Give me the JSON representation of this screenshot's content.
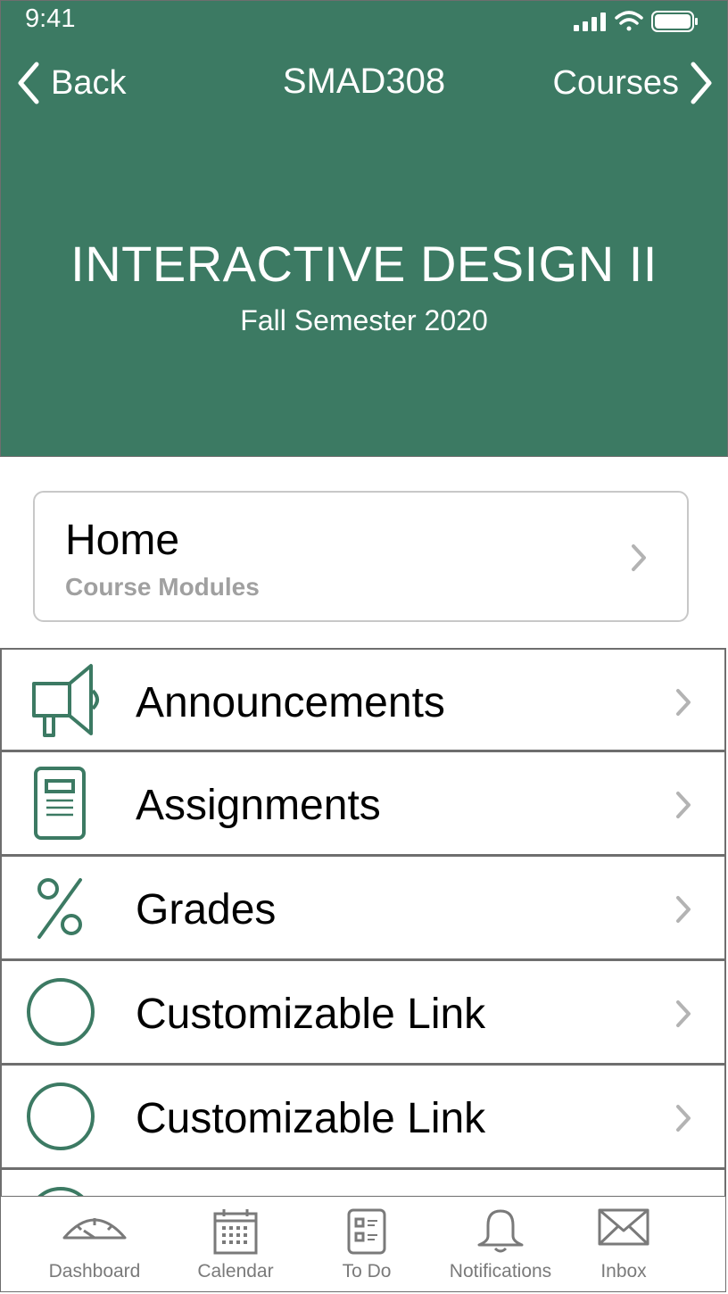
{
  "status_bar": {
    "time": "9:41"
  },
  "nav": {
    "back_label": "Back",
    "title": "SMAD308",
    "courses_label": "Courses"
  },
  "course": {
    "title": "INTERACTIVE DESIGN II",
    "subtitle": "Fall Semester 2020"
  },
  "home_card": {
    "title": "Home",
    "subtitle": "Course Modules"
  },
  "menu": {
    "items": [
      {
        "label": "Announcements",
        "icon": "megaphone-icon"
      },
      {
        "label": "Assignments",
        "icon": "document-icon"
      },
      {
        "label": "Grades",
        "icon": "percent-icon"
      },
      {
        "label": "Customizable Link",
        "icon": "circle-icon"
      },
      {
        "label": "Customizable Link",
        "icon": "circle-icon"
      }
    ]
  },
  "tabbar": {
    "items": [
      {
        "label": "Dashboard",
        "icon": "dashboard-gauge-icon"
      },
      {
        "label": "Calendar",
        "icon": "calendar-icon"
      },
      {
        "label": "To Do",
        "icon": "checklist-icon"
      },
      {
        "label": "Notifications",
        "icon": "bell-icon"
      },
      {
        "label": "Inbox",
        "icon": "envelope-icon"
      }
    ]
  },
  "colors": {
    "header_bg": "#3c7a63",
    "icon_green": "#3c7a63",
    "chevron": "#b3b3b3",
    "tab_gray": "#7a7a7a"
  }
}
